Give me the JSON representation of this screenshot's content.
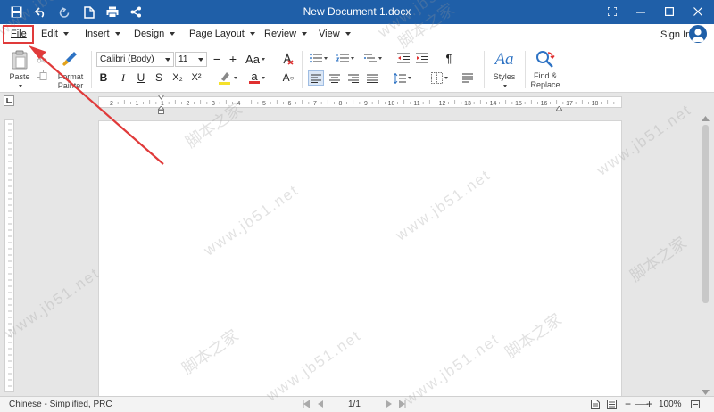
{
  "titlebar": {
    "title": "New Document 1.docx",
    "icons": [
      "save-icon",
      "undo-icon",
      "redo-icon",
      "new-document-icon",
      "print-icon",
      "share-icon"
    ],
    "window_buttons": [
      "fullscreen-icon",
      "minimize-icon",
      "maximize-icon",
      "close-icon"
    ]
  },
  "menubar": {
    "items": [
      {
        "label": "File"
      },
      {
        "label": "Edit"
      },
      {
        "label": "Insert"
      },
      {
        "label": "Design"
      },
      {
        "label": "Page Layout"
      },
      {
        "label": "Review"
      },
      {
        "label": "View"
      }
    ],
    "signin": "Sign In"
  },
  "ribbon": {
    "paste_label": "Paste",
    "format_painter_label": "Format\nPainter",
    "font_name": "Calibri (Body)",
    "font_size": "11",
    "grow_font": "+",
    "shrink_font": "−",
    "change_case": "Aa",
    "bold": "B",
    "italic": "I",
    "underline": "U",
    "strike": "S",
    "subscript": "X₂",
    "superscript": "X²",
    "font_color_glyph": "a",
    "clear_format": "A",
    "pilcrow": "¶",
    "styles_label": "Styles",
    "styles_glyph": "Aa",
    "find_label": "Find &\nReplace",
    "highlight_color": "#f5e12a",
    "font_color": "#e03030"
  },
  "ruler": {
    "labels": [
      "2",
      "1",
      "1",
      "2",
      "3",
      "4",
      "5",
      "6",
      "7",
      "8",
      "9",
      "10",
      "11",
      "12",
      "13",
      "14",
      "15",
      "16",
      "17",
      "18"
    ]
  },
  "watermark": {
    "text": "www.jb51.net",
    "cn": "脚本之家"
  },
  "statusbar": {
    "language": "Chinese - Simplified, PRC",
    "page": "1/1",
    "zoom": "100%",
    "zoom_minus": "−",
    "zoom_plus": "+"
  },
  "annotation": {
    "color": "#e03a3a"
  }
}
